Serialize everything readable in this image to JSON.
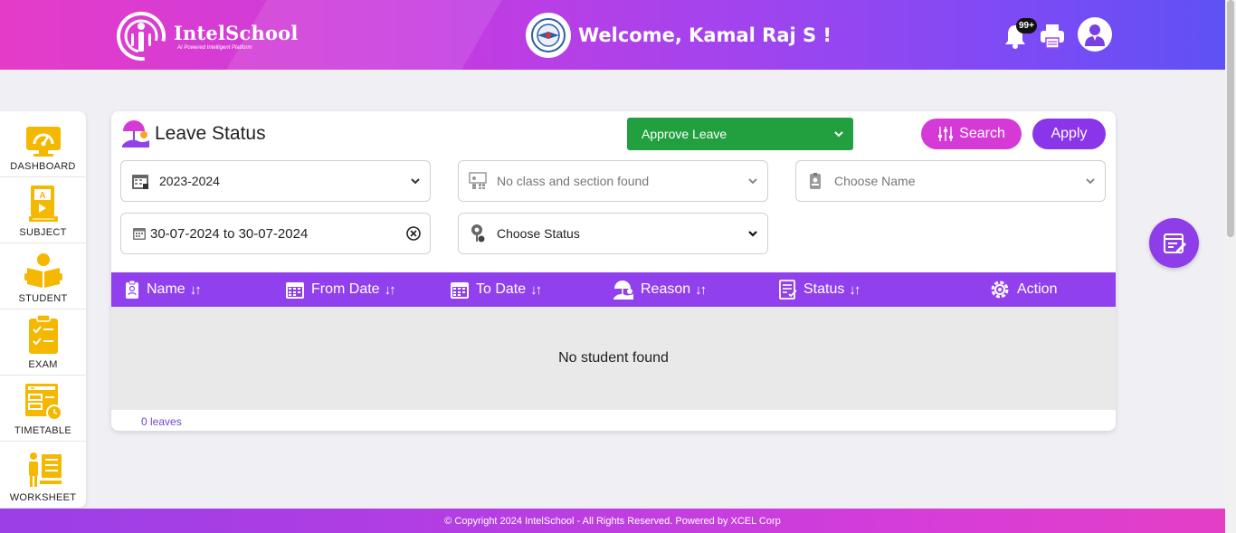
{
  "header": {
    "brand_name": "IntelSchool",
    "brand_tagline": "AI Powered Intelligent Platform",
    "welcome": "Welcome, Kamal Raj S !",
    "notification_count": "99+"
  },
  "sidebar": {
    "items": [
      {
        "label": "DASHBOARD",
        "icon": "dashboard-icon"
      },
      {
        "label": "SUBJECT",
        "icon": "subject-icon"
      },
      {
        "label": "STUDENT",
        "icon": "student-icon"
      },
      {
        "label": "EXAM",
        "icon": "exam-icon"
      },
      {
        "label": "TIMETABLE",
        "icon": "timetable-icon"
      },
      {
        "label": "WORKSHEET",
        "icon": "worksheet-icon"
      }
    ]
  },
  "card": {
    "title": "Leave Status",
    "leave_type_select": "Approve Leave",
    "search_label": "Search",
    "apply_label": "Apply",
    "filters": {
      "academic_year": "2023-2024",
      "class_section": "No class and section found",
      "name": "Choose Name",
      "date_range": "30-07-2024 to 30-07-2024",
      "status": "Choose Status"
    },
    "columns": [
      "Name",
      "From Date",
      "To Date",
      "Reason",
      "Status",
      "Action"
    ],
    "empty_message": "No student found",
    "count_label": "0 leaves"
  },
  "footer": {
    "copyright": "© Copyright 2024 IntelSchool - All Rights Reserved. Powered by XCEL Corp"
  },
  "colors": {
    "accent_purple": "#9140ee",
    "accent_magenta": "#d63ad6",
    "approve_green": "#22a03f",
    "sidebar_icon_yellow": "#f5b800"
  }
}
